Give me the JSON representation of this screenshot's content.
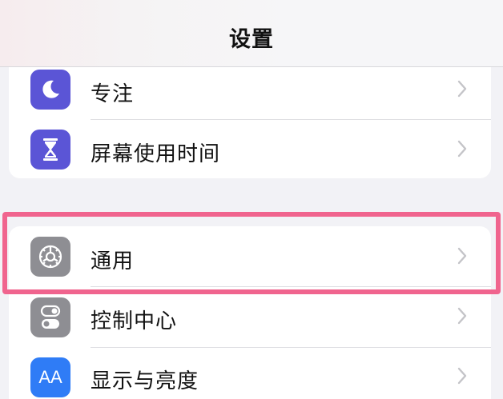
{
  "nav": {
    "title": "设置"
  },
  "groups": [
    {
      "items": [
        {
          "label": "专注",
          "icon": "moon-icon",
          "color": "#5b55d6"
        },
        {
          "label": "屏幕使用时间",
          "icon": "hourglass-icon",
          "color": "#5b55d6"
        }
      ]
    },
    {
      "items": [
        {
          "label": "通用",
          "icon": "gear-icon",
          "color": "#8e8e93"
        },
        {
          "label": "控制中心",
          "icon": "toggles-icon",
          "color": "#8e8e93"
        },
        {
          "label": "显示与亮度",
          "icon": "aa-icon",
          "icon_text": "AA",
          "color": "#2f7cf6"
        }
      ]
    }
  ],
  "highlight": {
    "color": "#f0648e",
    "target": "通用"
  }
}
